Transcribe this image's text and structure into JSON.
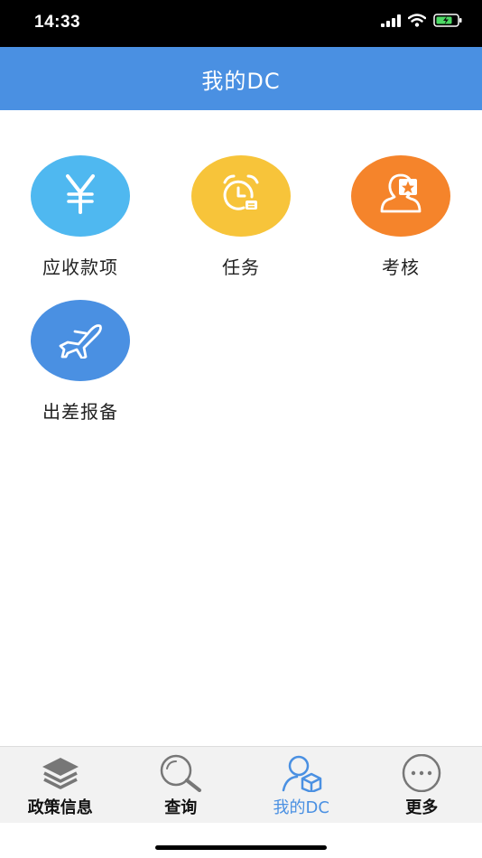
{
  "status": {
    "time": "14:33"
  },
  "header": {
    "title": "我的DC"
  },
  "colors": {
    "header": "#4a90e2",
    "active_tab": "#4a90e2",
    "receivables": "#4fb8f0",
    "tasks": "#f7c43a",
    "review": "#f5842b",
    "travel": "#4a90e2"
  },
  "tiles": [
    {
      "label": "应收款项",
      "icon": "yen-icon"
    },
    {
      "label": "任务",
      "icon": "alarm-clock-icon"
    },
    {
      "label": "考核",
      "icon": "person-star-icon"
    },
    {
      "label": "出差报备",
      "icon": "airplane-icon"
    }
  ],
  "tabs": [
    {
      "label": "政策信息",
      "icon": "layers-icon",
      "active": false
    },
    {
      "label": "查询",
      "icon": "search-icon",
      "active": false
    },
    {
      "label": "我的DC",
      "icon": "user-cube-icon",
      "active": true
    },
    {
      "label": "更多",
      "icon": "more-dots-icon",
      "active": false
    }
  ]
}
